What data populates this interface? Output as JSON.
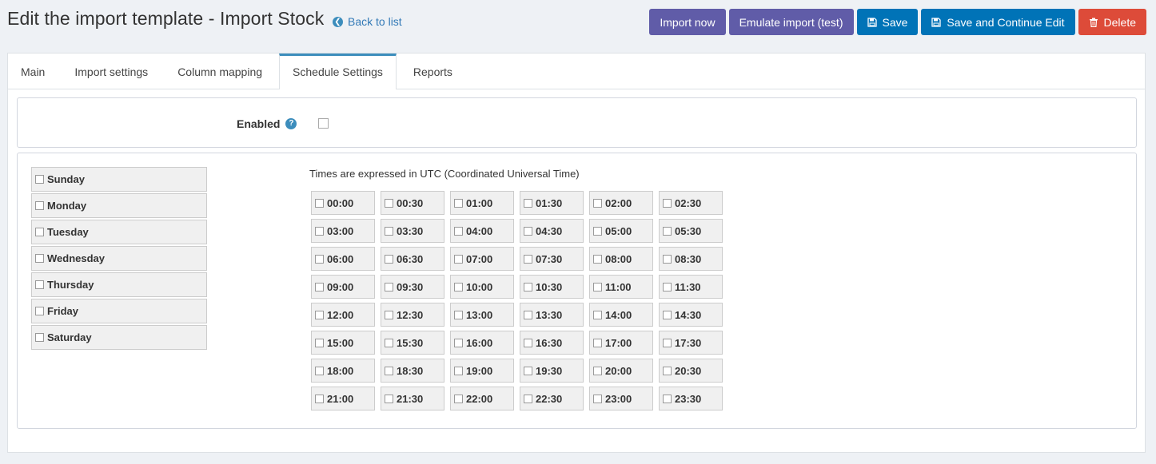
{
  "header": {
    "title": "Edit the import template - Import Stock",
    "back_label": "Back to list"
  },
  "toolbar": {
    "import_now": "Import now",
    "emulate": "Emulate import (test)",
    "save": "Save",
    "save_continue": "Save and Continue Edit",
    "delete": "Delete"
  },
  "tabs": [
    {
      "label": "Main"
    },
    {
      "label": "Import settings"
    },
    {
      "label": "Column mapping"
    },
    {
      "label": "Schedule Settings"
    },
    {
      "label": "Reports"
    }
  ],
  "enabled": {
    "label": "Enabled",
    "checked": false
  },
  "days": [
    "Sunday",
    "Monday",
    "Tuesday",
    "Wednesday",
    "Thursday",
    "Friday",
    "Saturday"
  ],
  "utc_note": "Times are expressed in UTC (Coordinated Universal Time)",
  "times": [
    "00:00",
    "00:30",
    "01:00",
    "01:30",
    "02:00",
    "02:30",
    "03:00",
    "03:30",
    "04:00",
    "04:30",
    "05:00",
    "05:30",
    "06:00",
    "06:30",
    "07:00",
    "07:30",
    "08:00",
    "08:30",
    "09:00",
    "09:30",
    "10:00",
    "10:30",
    "11:00",
    "11:30",
    "12:00",
    "12:30",
    "13:00",
    "13:30",
    "14:00",
    "14:30",
    "15:00",
    "15:30",
    "16:00",
    "16:30",
    "17:00",
    "17:30",
    "18:00",
    "18:30",
    "19:00",
    "19:30",
    "20:00",
    "20:30",
    "21:00",
    "21:30",
    "22:00",
    "22:30",
    "23:00",
    "23:30"
  ],
  "colors": {
    "purple": "#605ca8",
    "blue": "#0073b7",
    "red": "#dd4b39",
    "accent": "#3c8dbc"
  }
}
